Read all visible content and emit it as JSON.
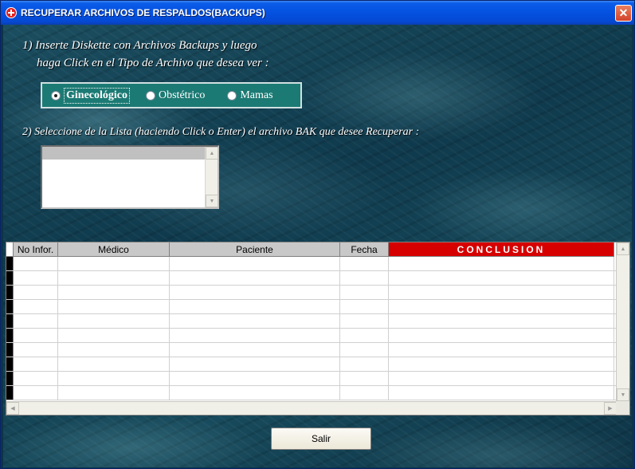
{
  "window": {
    "title": "RECUPERAR ARCHIVOS DE RESPALDOS(BACKUPS)",
    "close_label": "✕"
  },
  "step1": {
    "line1": "1) Inserte Diskette con Archivos Backups y luego",
    "line2": "haga Click en el Tipo de Archivo que desea ver :",
    "options": [
      {
        "label": "Ginecológico",
        "selected": true
      },
      {
        "label": "Obstétrico",
        "selected": false
      },
      {
        "label": "Mamas",
        "selected": false
      }
    ]
  },
  "step2": {
    "text": "2) Seleccione de la Lista (haciendo Click o Enter) el archivo BAK que desee Recuperar :"
  },
  "grid": {
    "columns": [
      "No Infor.",
      "Médico",
      "Paciente",
      "Fecha",
      "CONCLUSION"
    ],
    "row_count": 10
  },
  "footer": {
    "salir_label": "Salir"
  },
  "colors": {
    "titlebar": "#0551e0",
    "conclusion_header": "#d60000",
    "radio_panel": "#1c7a74"
  }
}
